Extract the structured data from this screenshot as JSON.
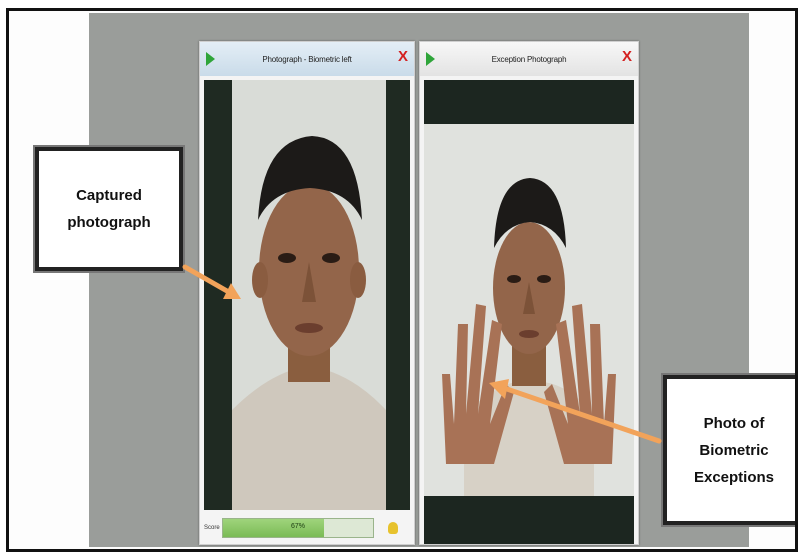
{
  "left_window": {
    "title": "Photograph - Biometric left",
    "score_label": "Score",
    "score_text": "67%",
    "score_fraction": 0.67,
    "icons": {
      "play": "play-icon",
      "close": "close-icon",
      "score_badge": "thumb-icon"
    }
  },
  "right_window": {
    "title": "Exception Photograph",
    "icons": {
      "play": "play-icon",
      "close": "close-icon"
    }
  },
  "callouts": {
    "left": "Captured photograph",
    "right": "Photo of Biometric Exceptions"
  },
  "colors": {
    "arrow": "#f2a35a",
    "close": "#d42020",
    "play": "#2fa53a",
    "score_fill": "#7abb55"
  }
}
